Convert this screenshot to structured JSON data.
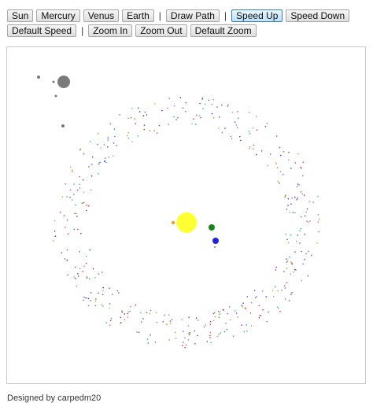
{
  "toolbar": {
    "row1": [
      {
        "label": "Sun",
        "active": false
      },
      {
        "label": "Mercury",
        "active": false
      },
      {
        "label": "Venus",
        "active": false
      },
      {
        "label": "Earth",
        "active": false
      },
      {
        "sep": "|"
      },
      {
        "label": "Draw Path",
        "active": false
      },
      {
        "sep": "|"
      },
      {
        "label": "Speed Up",
        "active": true
      },
      {
        "label": "Speed Down",
        "active": false
      }
    ],
    "row2": [
      {
        "label": "Default Speed",
        "active": false
      },
      {
        "sep": "|"
      },
      {
        "label": "Zoom In",
        "active": false
      },
      {
        "label": "Zoom Out",
        "active": false
      },
      {
        "label": "Default Zoom",
        "active": false
      }
    ]
  },
  "footer": {
    "text": "Designed by carpedm20"
  },
  "colors": {
    "sun": "#ffff33",
    "earth": "#118811",
    "venus": "#2222dd",
    "mercury": "#ff9900",
    "gray_bodies": "#7a7a7a",
    "asteroid_palette": [
      "#cc3333",
      "#3333cc",
      "#33aa33",
      "#cc33cc",
      "#33aaaa",
      "#aaaa33",
      "#555555",
      "#ff6633",
      "#6633ff",
      "#22bbbb"
    ]
  }
}
